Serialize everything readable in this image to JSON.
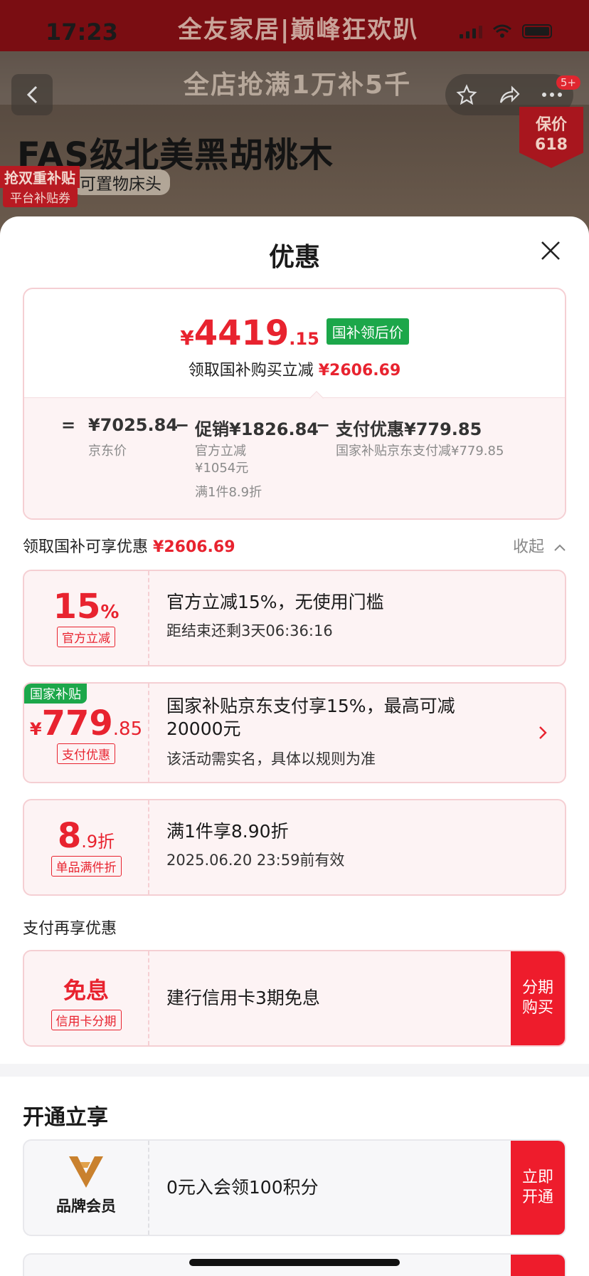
{
  "status_bar": {
    "time": "17:23"
  },
  "background_page": {
    "banner_title": "全友家居|巅峰狂欢趴",
    "sub_banner": "全店抢满1万补5千",
    "headline": "FAS级北美黑胡桃木",
    "subline": "可置物床头",
    "tag_subsidy": "抢双重补贴",
    "tag_platform": "平台补贴券",
    "badge_price": "保价",
    "badge_618": "618",
    "message_badge": "5+"
  },
  "sheet": {
    "title": "优惠",
    "summary": {
      "price_symbol": "¥",
      "price_int": "4419",
      "price_dec": ".15",
      "gov_tag": "国补领后价",
      "reduce_text": "领取国补购买立减",
      "reduce_amount": "¥2606.69",
      "eq_sign": "=",
      "jd_price": "¥7025.84",
      "jd_price_label": "京东价",
      "minus1": "−",
      "promo": "促销¥1826.84",
      "promo_sub1": "官方立减",
      "promo_sub2": "¥1054元",
      "promo_sub3": "满1件8.9折",
      "minus2": "−",
      "pay": "支付优惠¥779.85",
      "pay_sub": "国家补贴京东支付减¥779.85"
    },
    "gov_section": {
      "label": "领取国补可享优惠",
      "amount": "¥2606.69",
      "collapse": "收起"
    },
    "cards": [
      {
        "big": "15",
        "small": "%",
        "tag": "官方立减",
        "title": "官方立减15%，无使用门槛",
        "sub": "距结束还剩3天06:36:16"
      },
      {
        "corner": "国家补贴",
        "sym": "¥",
        "big": "779",
        "small": ".85",
        "tag": "支付优惠",
        "title": "国家补贴京东支付享15%，最高可减20000元",
        "sub": "该活动需实名，具体以规则为准"
      },
      {
        "big": "8",
        "small": ".9折",
        "tag": "单品满件折",
        "title": "满1件享8.90折",
        "sub": "2025.06.20 23:59前有效"
      }
    ],
    "pay_section": {
      "label": "支付再享优惠"
    },
    "pay_card": {
      "big": "免息",
      "tag": "信用卡分期",
      "title": "建行信用卡3期免息",
      "button": "分期购买"
    },
    "open_section": {
      "title": "开通立享"
    },
    "member_card": {
      "label": "品牌会员",
      "title": "0元入会领100积分",
      "button": "立即开通"
    }
  },
  "colors": {
    "accent": "#e8232f",
    "gov_green": "#1ca74a",
    "card_bg": "#fdf3f4"
  }
}
